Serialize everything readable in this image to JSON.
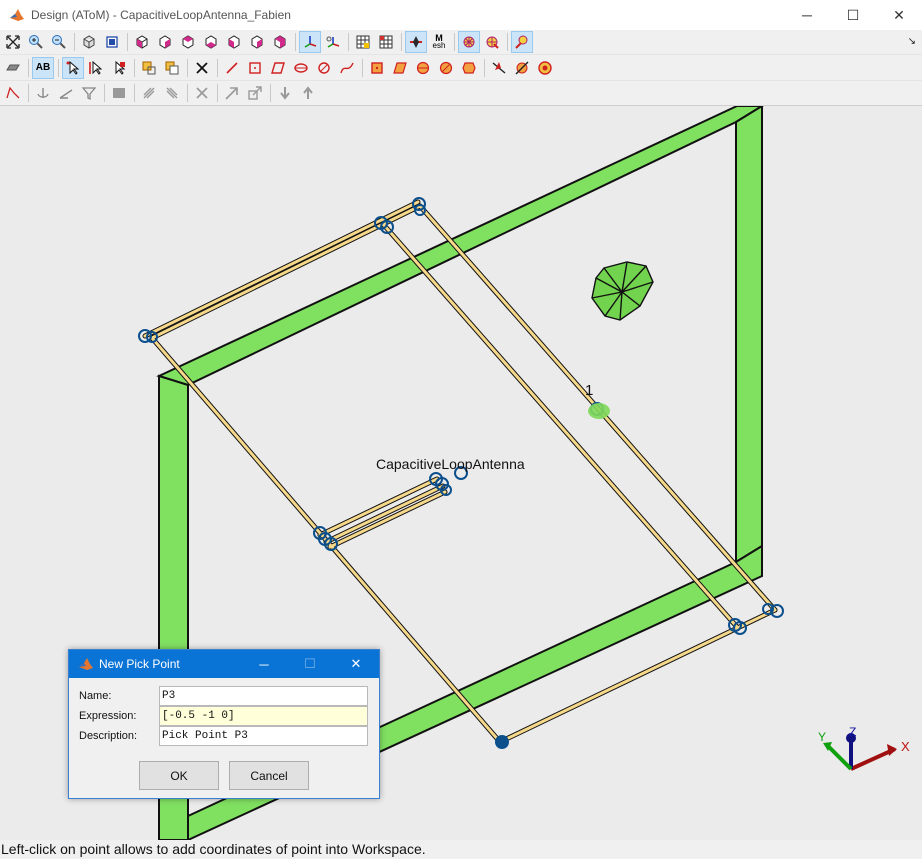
{
  "window": {
    "title": "Design (AToM) - CapacitiveLoopAntenna_Fabien",
    "minimize": "─",
    "maximize": "☐",
    "close": "✕"
  },
  "toolbar": {
    "mesh_label_top": "M",
    "mesh_label_bottom": "esh",
    "ab_label": "AB",
    "overflow": "↘"
  },
  "canvas": {
    "antenna_label": "CapacitiveLoopAntenna",
    "port_label": "1",
    "colors": {
      "frame": "#80e060",
      "wire": "#f5d88a",
      "node": "#0b4f8c",
      "background": "#ebebeb"
    },
    "axes": {
      "x": "X",
      "y": "Y",
      "z": "Z"
    }
  },
  "dialog": {
    "title": "New Pick Point",
    "fields": [
      {
        "label": "Name:",
        "value": "P3"
      },
      {
        "label": "Expression:",
        "value": "[-0.5 -1 0]"
      },
      {
        "label": "Description:",
        "value": "Pick Point P3"
      }
    ],
    "ok_label": "OK",
    "cancel_label": "Cancel"
  },
  "status": {
    "text": "Left-click on point allows to add coordinates of point into Workspace."
  }
}
